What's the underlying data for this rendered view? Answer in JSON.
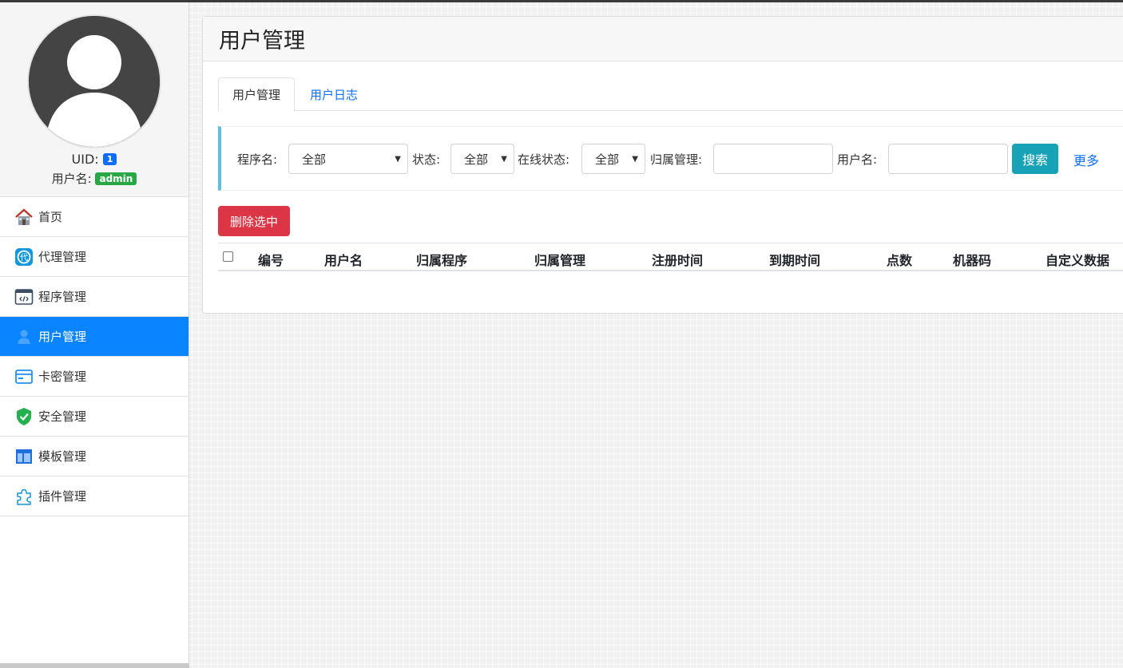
{
  "sidebar": {
    "uid_label": "UID:",
    "uid_value": "1",
    "username_label": "用户名:",
    "username_value": "admin",
    "items": [
      {
        "label": "首页",
        "icon": "home-icon"
      },
      {
        "label": "代理管理",
        "icon": "agent-icon"
      },
      {
        "label": "程序管理",
        "icon": "program-icon"
      },
      {
        "label": "用户管理",
        "icon": "user-icon",
        "active": true
      },
      {
        "label": "卡密管理",
        "icon": "card-icon"
      },
      {
        "label": "安全管理",
        "icon": "shield-icon"
      },
      {
        "label": "模板管理",
        "icon": "template-icon"
      },
      {
        "label": "插件管理",
        "icon": "plugin-icon"
      }
    ]
  },
  "panel": {
    "title": "用户管理",
    "tabs": [
      {
        "label": "用户管理",
        "active": true
      },
      {
        "label": "用户日志",
        "active": false
      }
    ]
  },
  "filter": {
    "program_label": "程序名:",
    "program_value": "全部",
    "status_label": "状态:",
    "status_value": "全部",
    "online_label": "在线状态:",
    "online_value": "全部",
    "owner_label": "归属管理:",
    "owner_value": "",
    "username_label": "用户名:",
    "username_value": "",
    "search_button": "搜索",
    "more_link": "更多"
  },
  "actions": {
    "delete_selected": "删除选中"
  },
  "table": {
    "columns": [
      "编号",
      "用户名",
      "归属程序",
      "归属管理",
      "注册时间",
      "到期时间",
      "点数",
      "机器码",
      "自定义数据"
    ]
  },
  "colors": {
    "active_nav": "#0a84ff",
    "search_button": "#17a2b8",
    "delete_button": "#dc3545",
    "uid_badge": "#0d6efd",
    "username_badge": "#28a745"
  }
}
